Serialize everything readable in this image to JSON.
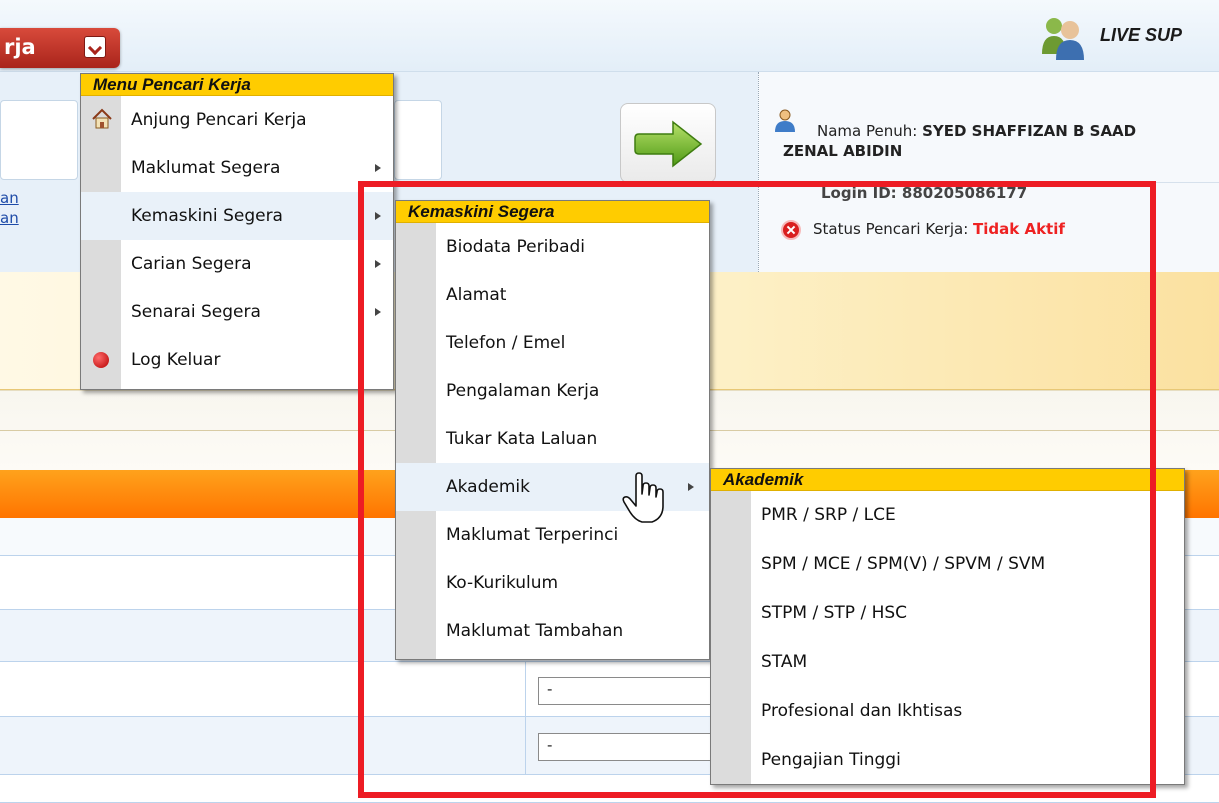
{
  "header": {
    "title_fragment": "rja",
    "live_support": "LIVE SUP"
  },
  "profile": {
    "name_label": "Nama Penuh:",
    "name_value": "SYED SHAFFIZAN B SAAD",
    "name_cont": "ZENAL ABIDIN",
    "login_partial": "Login ID: 880205086177",
    "status_label": "Status Pencari Kerja:",
    "status_value": "Tidak Aktif"
  },
  "left_links": [
    "an",
    "an"
  ],
  "form": {
    "select1_value": "-",
    "select2_value": "-"
  },
  "menu_main": {
    "header": "Menu Pencari Kerja",
    "items": [
      {
        "label": "Anjung Pencari Kerja",
        "icon": "home-icon"
      },
      {
        "label": "Maklumat Segera",
        "submenu": true
      },
      {
        "label": "Kemaskini Segera",
        "submenu": true,
        "active": true
      },
      {
        "label": "Carian Segera",
        "submenu": true
      },
      {
        "label": "Senarai Segera",
        "submenu": true
      },
      {
        "label": "Log Keluar",
        "icon": "logout-dot-icon"
      }
    ]
  },
  "menu_kemaskini": {
    "header": "Kemaskini Segera",
    "items": [
      {
        "label": "Biodata Peribadi"
      },
      {
        "label": "Alamat"
      },
      {
        "label": "Telefon / Emel"
      },
      {
        "label": "Pengalaman Kerja"
      },
      {
        "label": "Tukar Kata Laluan"
      },
      {
        "label": "Akademik",
        "submenu": true,
        "active": true
      },
      {
        "label": "Maklumat Terperinci"
      },
      {
        "label": "Ko-Kurikulum"
      },
      {
        "label": "Maklumat Tambahan"
      }
    ]
  },
  "menu_akademik": {
    "header": "Akademik",
    "items": [
      {
        "label": "PMR / SRP / LCE"
      },
      {
        "label": "SPM / MCE / SPM(V) / SPVM / SVM"
      },
      {
        "label": "STPM / STP / HSC"
      },
      {
        "label": "STAM"
      },
      {
        "label": "Profesional dan Ikhtisas"
      },
      {
        "label": "Pengajian Tinggi"
      }
    ]
  },
  "colors": {
    "menu_header": "#ffcc00",
    "highlight_frame": "#ed1c24",
    "status_inactive": "#ee2222",
    "title_tab": "#b82a1f"
  }
}
